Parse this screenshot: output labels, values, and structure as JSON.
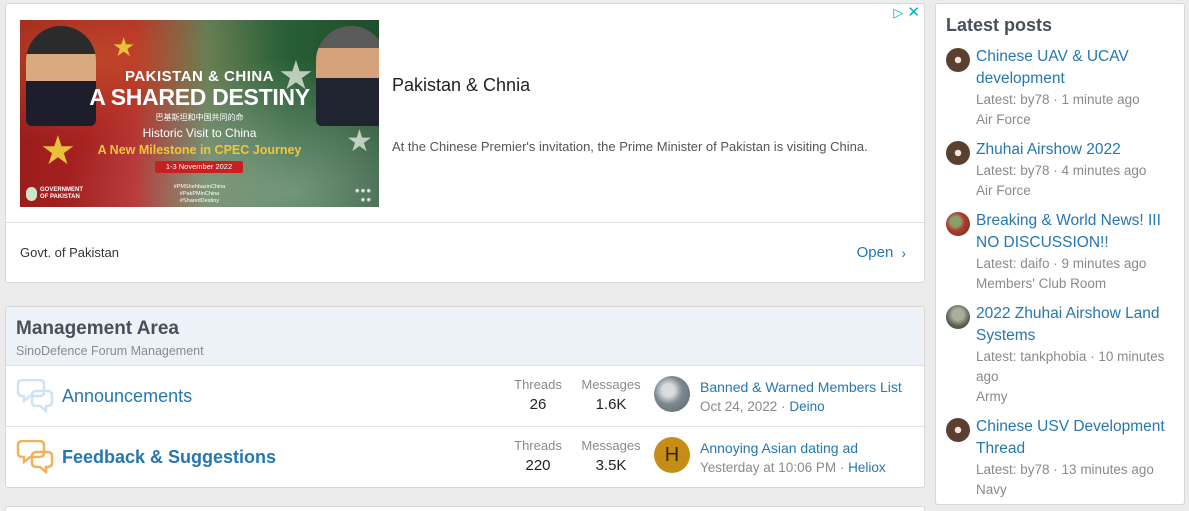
{
  "ad": {
    "image": {
      "line1": "PAKISTAN & CHINA",
      "line2": "A SHARED DESTINY",
      "line3": "巴基斯坦和中国共同的命",
      "line4": "Historic Visit to China",
      "line5": "A New Milestone in CPEC Journey",
      "date": "1-3 November 2022",
      "tags": [
        "#PMShehbazinChina",
        "#PakPMinChina",
        "#SharedDestiny"
      ],
      "gov": [
        "GOVERNMENT",
        "OF PAKISTAN"
      ]
    },
    "title": "Pakistan & Chnia",
    "description": "At the Chinese Premier's invitation, the Prime Minister of Pakistan is visiting China.",
    "source": "Govt. of Pakistan",
    "open_label": "Open",
    "open_icon": "chevron-right-icon",
    "adchoices_icon": "adchoices-icon",
    "close_icon": "close-icon"
  },
  "management": {
    "title": "Management Area",
    "subtitle": "SinoDefence Forum Management",
    "nodes": [
      {
        "title": "Announcements",
        "icon": "chat-bubbles-icon",
        "threads_label": "Threads",
        "threads": "26",
        "messages_label": "Messages",
        "messages": "1.6K",
        "last_title": "Banned & Warned Members List",
        "last_date": "Oct 24, 2022",
        "last_sep": "·",
        "last_user": "Deino"
      },
      {
        "title": "Feedback & Suggestions",
        "icon": "chat-bubbles-icon",
        "threads_label": "Threads",
        "threads": "220",
        "messages_label": "Messages",
        "messages": "3.5K",
        "avatar_letter": "H",
        "last_title": "Annoying Asian dating ad",
        "last_date": "Yesterday at 10:06 PM",
        "last_sep": "·",
        "last_user": "Heliox"
      }
    ]
  },
  "latest": {
    "title": "Latest posts",
    "posts": [
      {
        "title": "Chinese UAV & UCAV development",
        "meta": "Latest: by78 · 1 minute ago",
        "forum": "Air Force"
      },
      {
        "title": "Zhuhai Airshow 2022",
        "meta": "Latest: by78 · 4 minutes ago",
        "forum": "Air Force"
      },
      {
        "title": "Breaking & World News! III NO DISCUSSION!!",
        "meta": "Latest: daifo · 9 minutes ago",
        "forum": "Members' Club Room"
      },
      {
        "title": "2022 Zhuhai Airshow Land Systems",
        "meta": "Latest: tankphobia · 10 minutes ago",
        "forum": "Army"
      },
      {
        "title": "Chinese USV Development Thread",
        "meta": "Latest: by78 · 13 minutes ago",
        "forum": "Navy"
      }
    ]
  },
  "colors": {
    "link": "#2577b1",
    "muted": "#8a8a8a",
    "heading": "#47505a",
    "block_head_bg": "#edf2f8"
  }
}
